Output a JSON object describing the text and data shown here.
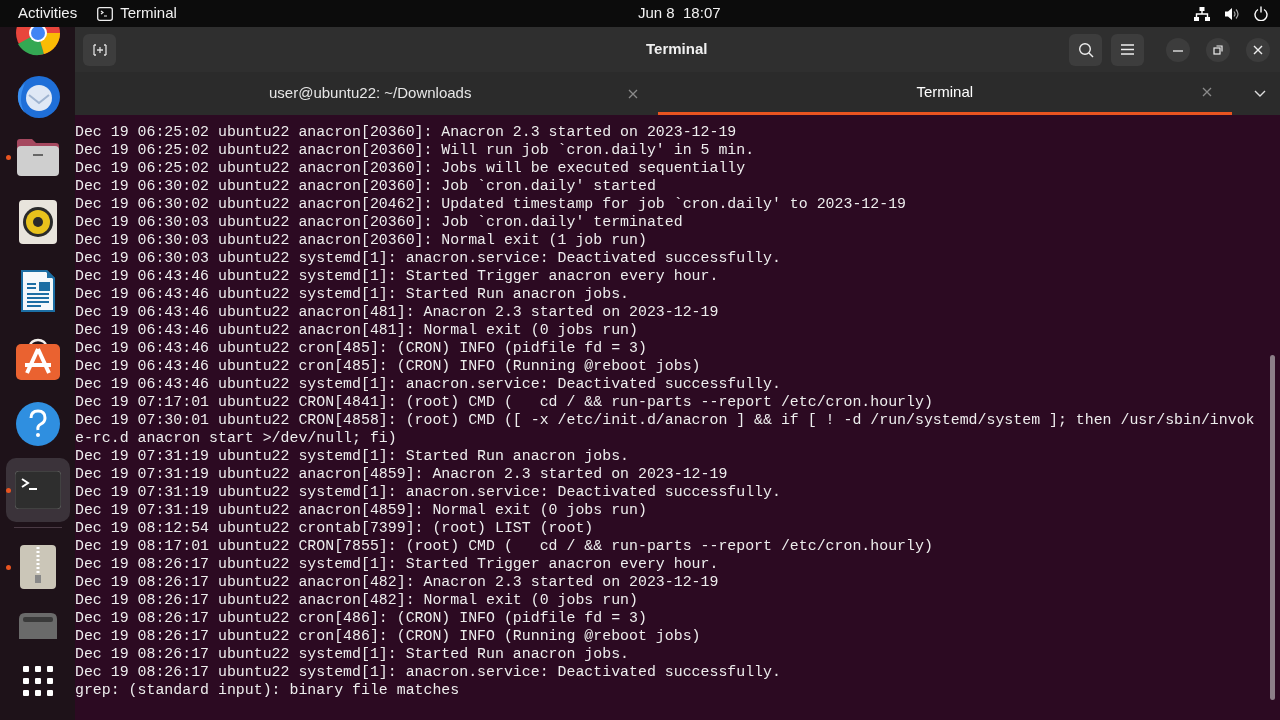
{
  "top_bar": {
    "activities": "Activities",
    "app_name": "Terminal",
    "clock": "Jun 8  18:07"
  },
  "dock": {
    "items": [
      {
        "kind": "browser",
        "running": false,
        "selected": false
      },
      {
        "kind": "mail",
        "running": false,
        "selected": false
      },
      {
        "kind": "files",
        "running": true,
        "selected": false
      },
      {
        "kind": "music",
        "running": false,
        "selected": false
      },
      {
        "kind": "writer",
        "running": false,
        "selected": false
      },
      {
        "kind": "store",
        "running": false,
        "selected": false
      },
      {
        "kind": "help",
        "running": false,
        "selected": false
      },
      {
        "kind": "terminal",
        "running": true,
        "selected": true
      },
      {
        "kind": "separator"
      },
      {
        "kind": "archive",
        "running": true,
        "selected": false
      },
      {
        "kind": "drive",
        "running": false,
        "selected": false
      },
      {
        "kind": "apps",
        "running": false,
        "selected": false
      }
    ]
  },
  "window": {
    "title": "Terminal"
  },
  "tabs": [
    {
      "label": "user@ubuntu22: ~/Downloads",
      "selected": false
    },
    {
      "label": "Terminal",
      "selected": true
    }
  ],
  "terminal": {
    "lines": [
      "Dec 19 06:25:02 ubuntu22 anacron[20360]: Anacron 2.3 started on 2023-12-19",
      "Dec 19 06:25:02 ubuntu22 anacron[20360]: Will run job `cron.daily' in 5 min.",
      "Dec 19 06:25:02 ubuntu22 anacron[20360]: Jobs will be executed sequentially",
      "Dec 19 06:30:02 ubuntu22 anacron[20360]: Job `cron.daily' started",
      "Dec 19 06:30:02 ubuntu22 anacron[20462]: Updated timestamp for job `cron.daily' to 2023-12-19",
      "Dec 19 06:30:03 ubuntu22 anacron[20360]: Job `cron.daily' terminated",
      "Dec 19 06:30:03 ubuntu22 anacron[20360]: Normal exit (1 job run)",
      "Dec 19 06:30:03 ubuntu22 systemd[1]: anacron.service: Deactivated successfully.",
      "Dec 19 06:43:46 ubuntu22 systemd[1]: Started Trigger anacron every hour.",
      "Dec 19 06:43:46 ubuntu22 systemd[1]: Started Run anacron jobs.",
      "Dec 19 06:43:46 ubuntu22 anacron[481]: Anacron 2.3 started on 2023-12-19",
      "Dec 19 06:43:46 ubuntu22 anacron[481]: Normal exit (0 jobs run)",
      "Dec 19 06:43:46 ubuntu22 cron[485]: (CRON) INFO (pidfile fd = 3)",
      "Dec 19 06:43:46 ubuntu22 cron[485]: (CRON) INFO (Running @reboot jobs)",
      "Dec 19 06:43:46 ubuntu22 systemd[1]: anacron.service: Deactivated successfully.",
      "Dec 19 07:17:01 ubuntu22 CRON[4841]: (root) CMD (   cd / && run-parts --report /etc/cron.hourly)",
      "Dec 19 07:30:01 ubuntu22 CRON[4858]: (root) CMD ([ -x /etc/init.d/anacron ] && if [ ! -d /run/systemd/system ]; then /usr/sbin/invok",
      "e-rc.d anacron start >/dev/null; fi)",
      "Dec 19 07:31:19 ubuntu22 systemd[1]: Started Run anacron jobs.",
      "Dec 19 07:31:19 ubuntu22 anacron[4859]: Anacron 2.3 started on 2023-12-19",
      "Dec 19 07:31:19 ubuntu22 systemd[1]: anacron.service: Deactivated successfully.",
      "Dec 19 07:31:19 ubuntu22 anacron[4859]: Normal exit (0 jobs run)",
      "Dec 19 08:12:54 ubuntu22 crontab[7399]: (root) LIST (root)",
      "Dec 19 08:17:01 ubuntu22 CRON[7855]: (root) CMD (   cd / && run-parts --report /etc/cron.hourly)",
      "Dec 19 08:26:17 ubuntu22 systemd[1]: Started Trigger anacron every hour.",
      "Dec 19 08:26:17 ubuntu22 anacron[482]: Anacron 2.3 started on 2023-12-19",
      "Dec 19 08:26:17 ubuntu22 anacron[482]: Normal exit (0 jobs run)",
      "Dec 19 08:26:17 ubuntu22 cron[486]: (CRON) INFO (pidfile fd = 3)",
      "Dec 19 08:26:17 ubuntu22 cron[486]: (CRON) INFO (Running @reboot jobs)",
      "Dec 19 08:26:17 ubuntu22 systemd[1]: Started Run anacron jobs.",
      "Dec 19 08:26:17 ubuntu22 systemd[1]: anacron.service: Deactivated successfully.",
      "grep: (standard input): binary file matches"
    ]
  }
}
